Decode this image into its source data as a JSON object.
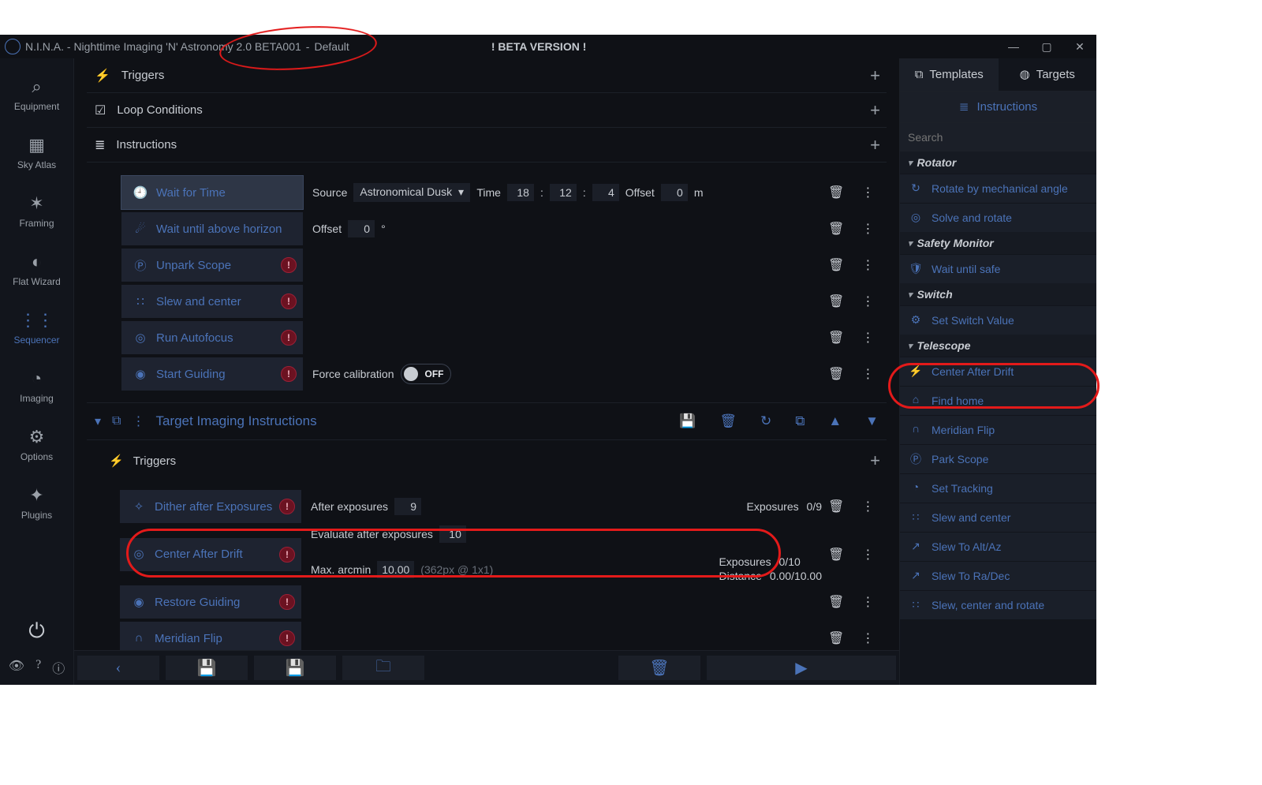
{
  "titlebar": {
    "app": "N.I.N.A. - Nighttime Imaging 'N' Astronomy 2.0 BETA001",
    "profile": "Default",
    "beta_tag": "! BETA VERSION !"
  },
  "nav": {
    "items": [
      {
        "label": "Equipment"
      },
      {
        "label": "Sky Atlas"
      },
      {
        "label": "Framing"
      },
      {
        "label": "Flat Wizard"
      },
      {
        "label": "Sequencer"
      },
      {
        "label": "Imaging"
      },
      {
        "label": "Options"
      },
      {
        "label": "Plugins"
      }
    ]
  },
  "sections": {
    "triggers": "Triggers",
    "loop": "Loop Conditions",
    "instructions": "Instructions"
  },
  "instructions": [
    {
      "label": "Wait for Time",
      "selected": true,
      "params": {
        "source_lbl": "Source",
        "source_val": "Astronomical Dusk",
        "time_lbl": "Time",
        "h": "18",
        "m": "12",
        "s": "4",
        "offset_lbl": "Offset",
        "offset_val": "0",
        "offset_unit": "m"
      }
    },
    {
      "label": "Wait until above horizon",
      "params": {
        "offset_lbl": "Offset",
        "offset_val": "0",
        "offset_unit": "°"
      }
    },
    {
      "label": "Unpark Scope",
      "warn": true
    },
    {
      "label": "Slew and center",
      "warn": true
    },
    {
      "label": "Run Autofocus",
      "warn": true
    },
    {
      "label": "Start Guiding",
      "warn": true,
      "params": {
        "force_lbl": "Force calibration",
        "force_val": "OFF"
      }
    }
  ],
  "tii": {
    "title": "Target Imaging Instructions"
  },
  "tii_triggers_label": "Triggers",
  "tii_triggers": [
    {
      "label": "Dither after Exposures",
      "warn": true,
      "p": {
        "lbl": "After exposures",
        "val": "9",
        "stat_lbl": "Exposures",
        "stat_val": "0/9"
      }
    },
    {
      "label": "Center After Drift",
      "warn": true,
      "p": {
        "eval_lbl": "Evaluate after exposures",
        "eval_val": "10",
        "max_lbl": "Max. arcmin",
        "max_val": "10.00",
        "hint": "(362px @ 1x1)",
        "exp_lbl": "Exposures",
        "exp_val": "0/10",
        "dist_lbl": "Distance",
        "dist_val": "0.00/10.00"
      }
    },
    {
      "label": "Restore Guiding",
      "warn": true
    },
    {
      "label": "Meridian Flip",
      "warn": true
    }
  ],
  "right": {
    "tabs": {
      "templates": "Templates",
      "targets": "Targets"
    },
    "instructions_link": "Instructions",
    "search_placeholder": "Search",
    "cats": [
      {
        "title": "Rotator",
        "items": [
          "Rotate by mechanical angle",
          "Solve and rotate"
        ]
      },
      {
        "title": "Safety Monitor",
        "items": [
          "Wait until safe"
        ]
      },
      {
        "title": "Switch",
        "items": [
          "Set Switch Value"
        ]
      },
      {
        "title": "Telescope",
        "items": [
          "Center After Drift",
          "Find home",
          "Meridian Flip",
          "Park Scope",
          "Set Tracking",
          "Slew and center",
          "Slew To Alt/Az",
          "Slew To Ra/Dec",
          "Slew, center and rotate"
        ]
      }
    ]
  }
}
